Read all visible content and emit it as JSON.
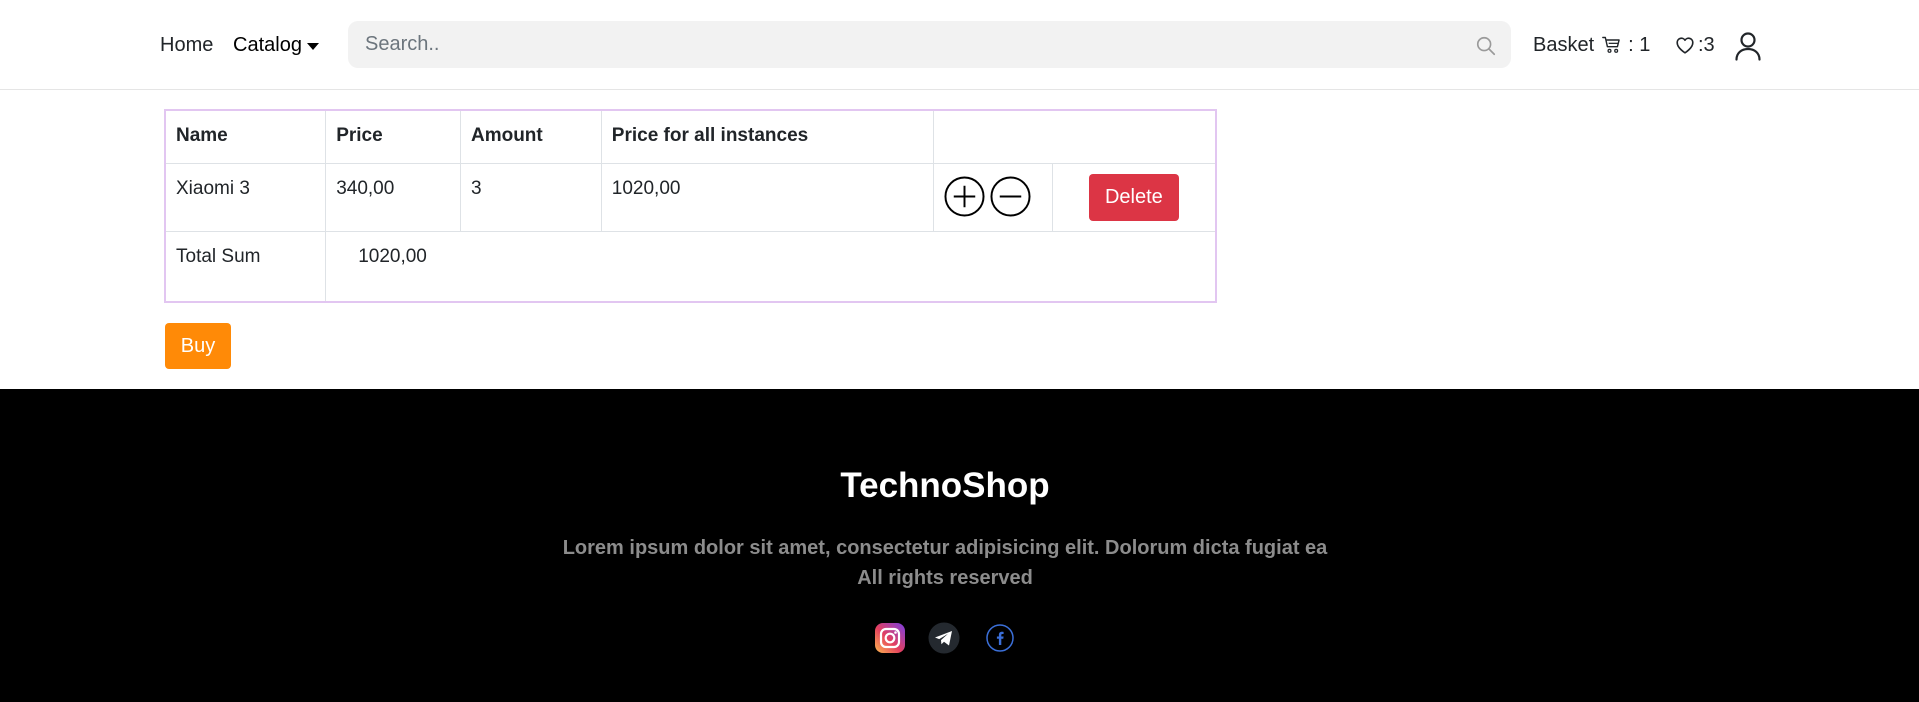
{
  "header": {
    "nav": {
      "home": "Home",
      "catalog": "Catalog"
    },
    "search": {
      "placeholder": "Search.."
    },
    "basket": {
      "label": "Basket",
      "count": ": 1"
    },
    "favorites": {
      "count": ":3"
    }
  },
  "table": {
    "headers": [
      "Name",
      "Price",
      "Amount",
      "Price for all instances",
      ""
    ],
    "items": [
      {
        "name": "Xiaomi 3",
        "price": "340,00",
        "amount": "3",
        "total": "1020,00",
        "delete_label": "Delete"
      }
    ],
    "total_label": "Total Sum",
    "total_value": "1020,00"
  },
  "buy_label": "Buy",
  "footer": {
    "title": "TechnoShop",
    "text": "Lorem ipsum dolor sit amet, consectetur adipisicing elit. Dolorum dicta fugiat ea All rights reserved"
  },
  "colors": {
    "delete": "#dc3545",
    "buy": "#ff8a07",
    "table_border": "#e2c6f1",
    "footer_bg": "#000000"
  },
  "icons": [
    "search-icon",
    "cart-icon",
    "heart-icon",
    "user-icon",
    "plus-circle-icon",
    "minus-circle-icon",
    "instagram-icon",
    "telegram-icon",
    "facebook-icon"
  ]
}
